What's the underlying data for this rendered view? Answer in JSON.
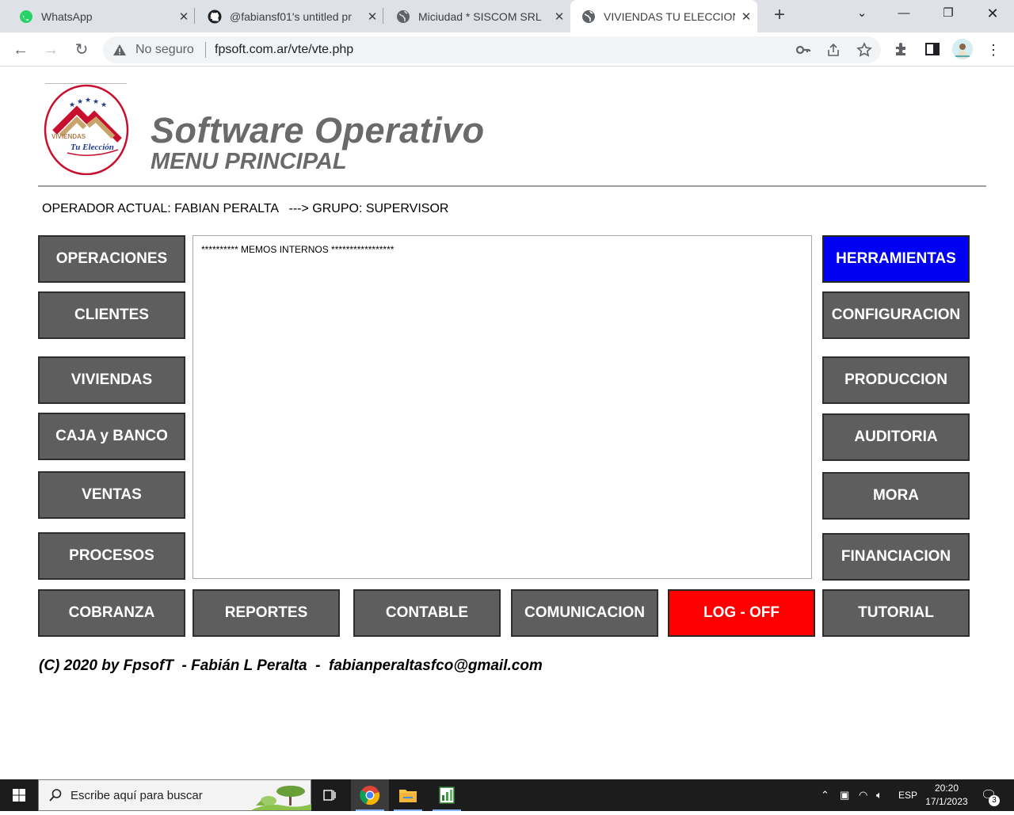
{
  "browser": {
    "tabs": [
      {
        "title": "WhatsApp"
      },
      {
        "title": "@fabiansf01's untitled pr"
      },
      {
        "title": "Miciudad * SISCOM SRL"
      },
      {
        "title": "VIVIENDAS TU ELECCION"
      }
    ],
    "address": {
      "security_label": "No seguro",
      "url": "fpsoft.com.ar/vte/vte.php"
    }
  },
  "header": {
    "logo_text_top": "VIVIENDAS",
    "logo_text_bottom": "Tu Elección",
    "title": "Software Operativo",
    "subtitle": "MENU PRINCIPAL"
  },
  "operator_line": "OPERADOR ACTUAL: FABIAN PERALTA   ---> GRUPO: SUPERVISOR",
  "menu": {
    "left": [
      "OPERACIONES",
      "CLIENTES",
      "VIVIENDAS",
      "CAJA y BANCO",
      "VENTAS",
      "PROCESOS"
    ],
    "right": [
      "HERRAMIENTAS",
      "CONFIGURACION",
      "PRODUCCION",
      "AUDITORIA",
      "MORA",
      "FINANCIACION"
    ],
    "bottom": [
      "COBRANZA",
      "REPORTES",
      "CONTABLE",
      "COMUNICACION",
      "LOG - OFF",
      "TUTORIAL"
    ]
  },
  "memo_text": "********** MEMOS INTERNOS *****************",
  "footer": "(C) 2020 by FpsofT  - Fabián L Peralta  -  fabianperaltasfco@gmail.com",
  "colors": {
    "button_gray": "#5e5e5e",
    "button_blue": "#0000f2",
    "button_red": "#ff0000"
  },
  "taskbar": {
    "search_placeholder": "Escribe aquí para buscar",
    "language": "ESP",
    "time": "20:20",
    "date": "17/1/2023",
    "notification_count": "3"
  }
}
